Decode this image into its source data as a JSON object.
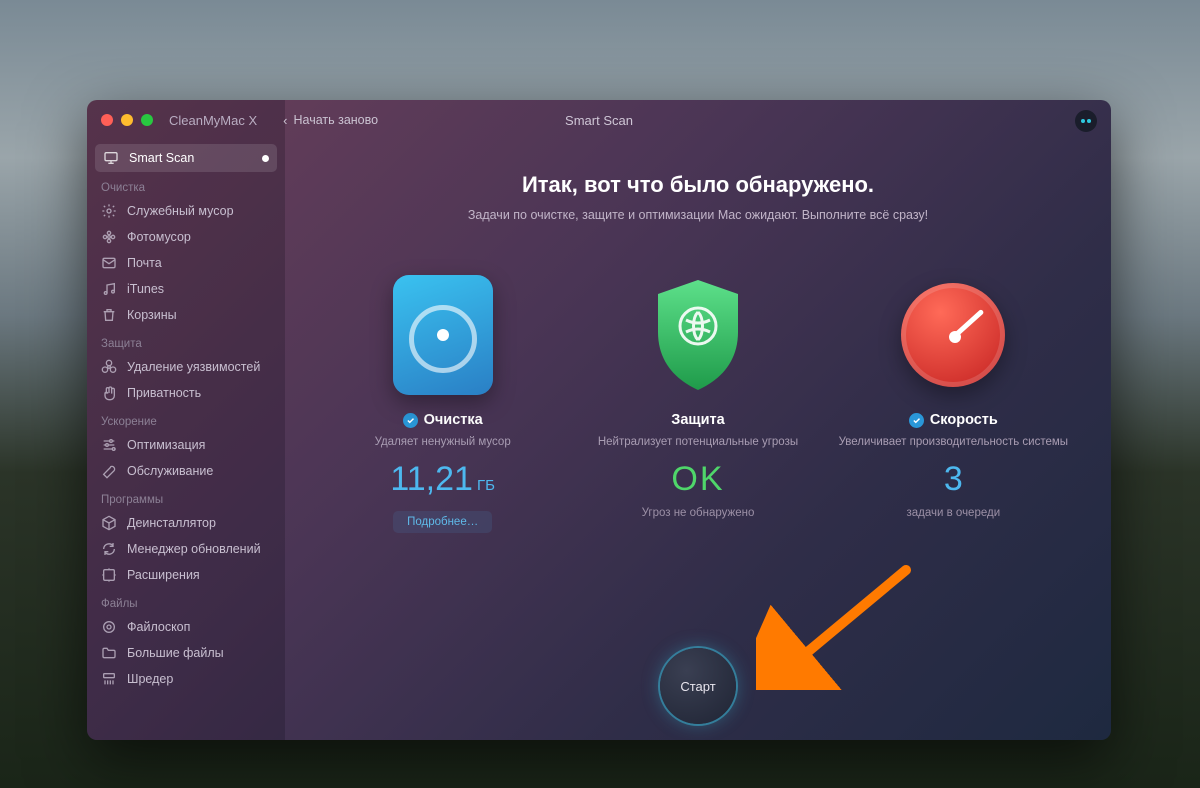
{
  "app_title": "CleanMyMac X",
  "back_label": "Начать заново",
  "window_title": "Smart Scan",
  "sidebar": {
    "smart_scan": "Smart Scan",
    "sections": [
      {
        "heading": "Очистка",
        "items": [
          "Служебный мусор",
          "Фотомусор",
          "Почта",
          "iTunes",
          "Корзины"
        ]
      },
      {
        "heading": "Защита",
        "items": [
          "Удаление уязвимостей",
          "Приватность"
        ]
      },
      {
        "heading": "Ускорение",
        "items": [
          "Оптимизация",
          "Обслуживание"
        ]
      },
      {
        "heading": "Программы",
        "items": [
          "Деинсталлятор",
          "Менеджер обновлений",
          "Расширения"
        ]
      },
      {
        "heading": "Файлы",
        "items": [
          "Файлоскоп",
          "Большие файлы",
          "Шредер"
        ]
      }
    ]
  },
  "main": {
    "heading": "Итак, вот что было обнаружено.",
    "sub": "Задачи по очистке, защите и оптимизации Mac ожидают. Выполните всё сразу!",
    "cleanup": {
      "title": "Очистка",
      "desc": "Удаляет ненужный мусор",
      "value": "11,21",
      "unit": "ГБ",
      "more": "Подробнее…"
    },
    "protect": {
      "title": "Защита",
      "desc": "Нейтрализует потенциальные угрозы",
      "value": "OK",
      "foot": "Угроз не обнаружено"
    },
    "speed": {
      "title": "Скорость",
      "desc": "Увеличивает производительность системы",
      "value": "3",
      "foot": "задачи в очереди"
    },
    "start": "Старт"
  }
}
